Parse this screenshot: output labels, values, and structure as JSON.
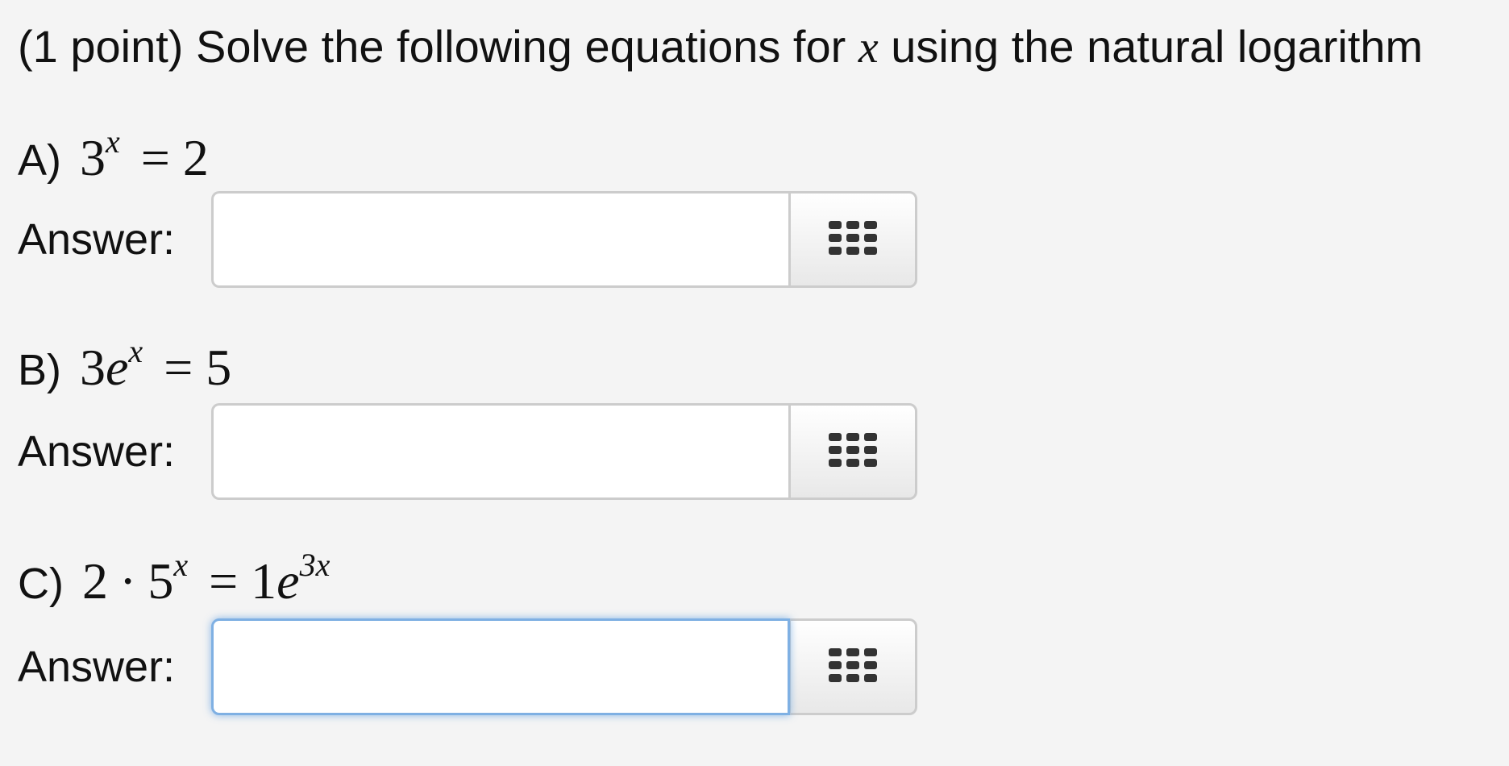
{
  "prompt": {
    "lead": "(1 point) Solve the following equations for",
    "variable": "x",
    "tail": "using the natural logarithm"
  },
  "questions": [
    {
      "label": "A)",
      "base": "3",
      "exponent": "x",
      "equals": "=",
      "rhs": "2",
      "answer_label": "Answer:",
      "answer_value": "",
      "palette_icon": "grid-icon"
    },
    {
      "label": "B)",
      "coefficient": "3",
      "base": "e",
      "exponent": "x",
      "equals": "=",
      "rhs": "5",
      "answer_label": "Answer:",
      "answer_value": "",
      "palette_icon": "grid-icon"
    },
    {
      "label": "C)",
      "coefficient": "2",
      "dot": "·",
      "base": "5",
      "exponent": "x",
      "equals": "=",
      "rhs_coefficient": "1",
      "rhs_base": "e",
      "rhs_exponent": "3x",
      "answer_label": "Answer:",
      "answer_value": "",
      "palette_icon": "grid-icon",
      "focused": true
    }
  ],
  "colors": {
    "background": "#f4f4f4",
    "input_border": "#cccccc",
    "focus_border": "#7fb0e3",
    "icon": "#333333"
  }
}
